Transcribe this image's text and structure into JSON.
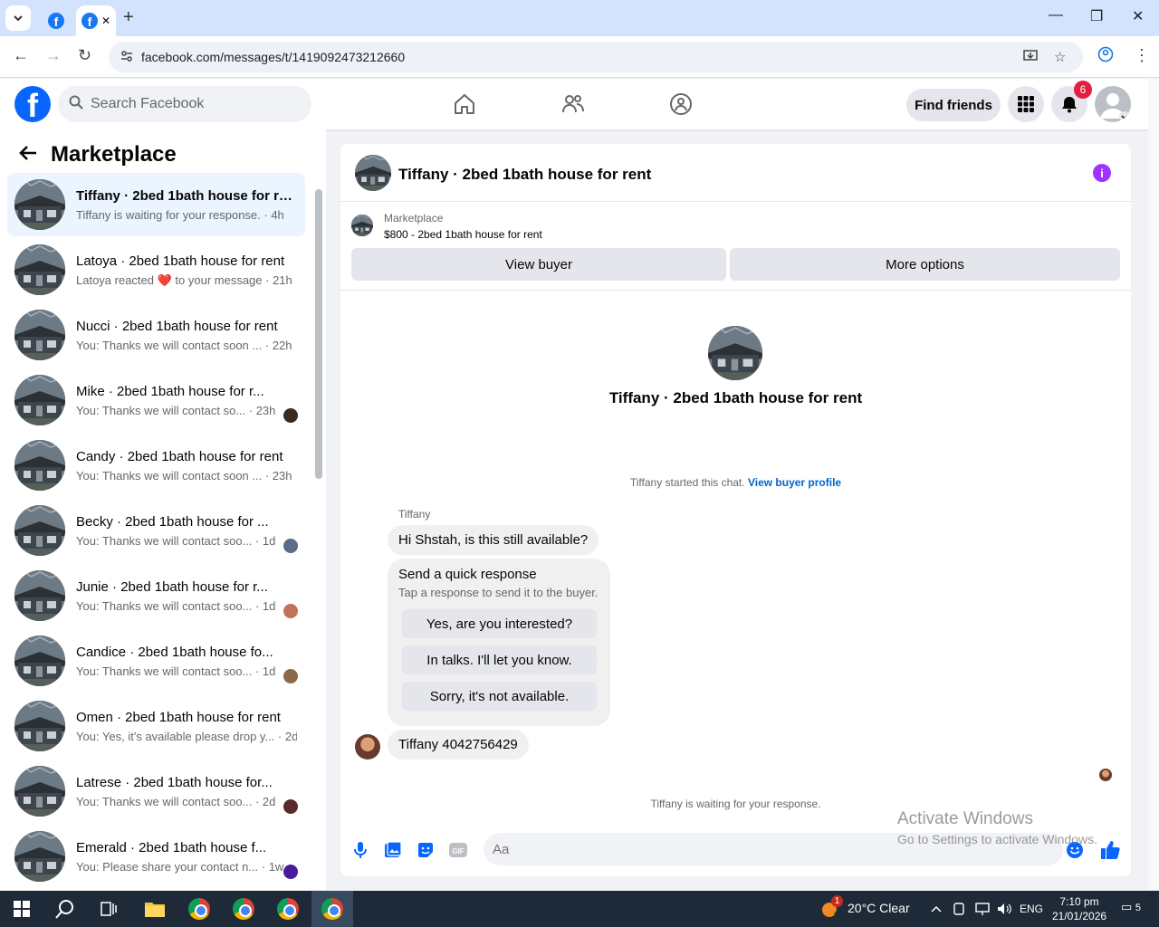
{
  "browser": {
    "url": "facebook.com/messages/t/1419092473212660",
    "new_tab": "+",
    "minimize": "—",
    "restore": "❐",
    "close": "✕"
  },
  "header": {
    "search_placeholder": "Search Facebook",
    "find_friends": "Find friends",
    "notifications_count": "6",
    "logo_letter": "f"
  },
  "sidebar": {
    "title": "Marketplace",
    "conversations": [
      {
        "name": "Tiffany · 2bed 1bath house for re...",
        "sub": "Tiffany is waiting for your response. · 4h",
        "active": true,
        "avatar_color": ""
      },
      {
        "name": "Latoya · 2bed 1bath house for rent",
        "sub": "Latoya reacted ❤️ to your message · 21h",
        "active": false,
        "avatar_color": ""
      },
      {
        "name": "Nucci · 2bed 1bath house for rent",
        "sub": "You: Thanks we will contact soon ... · 22h",
        "active": false,
        "avatar_color": ""
      },
      {
        "name": "Mike · 2bed 1bath house for r...",
        "sub": "You: Thanks we will contact so... · 23h",
        "active": false,
        "avatar_color": "#3a2a22"
      },
      {
        "name": "Candy · 2bed 1bath house for rent",
        "sub": "You: Thanks we will contact soon ... · 23h",
        "active": false,
        "avatar_color": ""
      },
      {
        "name": "Becky · 2bed 1bath house for ...",
        "sub": "You: Thanks we will contact soo... · 1d",
        "active": false,
        "avatar_color": "#5a6b8c"
      },
      {
        "name": "Junie · 2bed 1bath house for r...",
        "sub": "You: Thanks we will contact soo... · 1d",
        "active": false,
        "avatar_color": "#c0735a"
      },
      {
        "name": "Candice · 2bed 1bath house fo...",
        "sub": "You: Thanks we will contact soo... · 1d",
        "active": false,
        "avatar_color": "#8a6a4a"
      },
      {
        "name": "Omen · 2bed 1bath house for rent",
        "sub": "You: Yes, it's available please drop y... · 2d",
        "active": false,
        "avatar_color": ""
      },
      {
        "name": "Latrese · 2bed 1bath house for...",
        "sub": "You: Thanks we will contact soo... · 2d",
        "active": false,
        "avatar_color": "#5a2a2a"
      },
      {
        "name": "Emerald · 2bed 1bath house f...",
        "sub": "You: Please share your contact n... · 1w",
        "active": false,
        "avatar_color": "#4a1a9a"
      }
    ]
  },
  "chat": {
    "title": "Tiffany · 2bed 1bath house for rent",
    "listing_label": "Marketplace",
    "listing_price": "$800 - 2bed 1bath house for rent",
    "view_buyer": "View buyer",
    "more_options": "More options",
    "center_title": "Tiffany · 2bed 1bath house for rent",
    "started_text": "Tiffany started this chat.",
    "view_buyer_profile": "View buyer profile",
    "sender_name": "Tiffany",
    "message1": "Hi Shstah, is this still available?",
    "quick_title": "Send a quick response",
    "quick_sub": "Tap a response to send it to the buyer.",
    "quick_options": [
      "Yes, are you interested?",
      "In talks. I'll let you know.",
      "Sorry, it's not available."
    ],
    "message2": "Tiffany 4042756429",
    "waiting": "Tiffany is waiting for your response.",
    "composer_placeholder": "Aa"
  },
  "watermark": {
    "line1": "Activate Windows",
    "line2": "Go to Settings to activate Windows."
  },
  "taskbar": {
    "weather": "20°C  Clear",
    "weather_badge": "1",
    "lang": "ENG",
    "time": "7:10 pm",
    "date": "21/01/2026",
    "notif_count": "5"
  }
}
